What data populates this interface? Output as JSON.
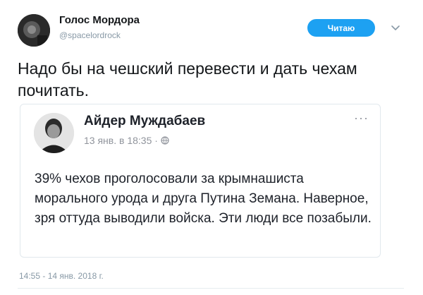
{
  "tweet": {
    "author_name": "Голос Мордора",
    "author_handle": "@spacelordrock",
    "follow_label": "Читаю",
    "text": "Надо бы на чешский перевести и дать чехам почитать.",
    "timestamp": "14:55 - 14 янв. 2018 г."
  },
  "quote": {
    "author_name": "Айдер Муждабаев",
    "date": "13 янв. в 18:35 ·",
    "more": "···",
    "text": "39% чехов проголосовали за крымнашиста морального урода и друга Путина Земана. Наверное, зря оттуда выводили войска. Эти люди все позабыли."
  },
  "icons": {
    "more": "more-dots-icon",
    "privacy": "globe-icon",
    "menu": "chevron-down-icon"
  },
  "colors": {
    "accent": "#1da1f2",
    "secondary_text": "#8899a6",
    "border": "#e1e8ed"
  }
}
